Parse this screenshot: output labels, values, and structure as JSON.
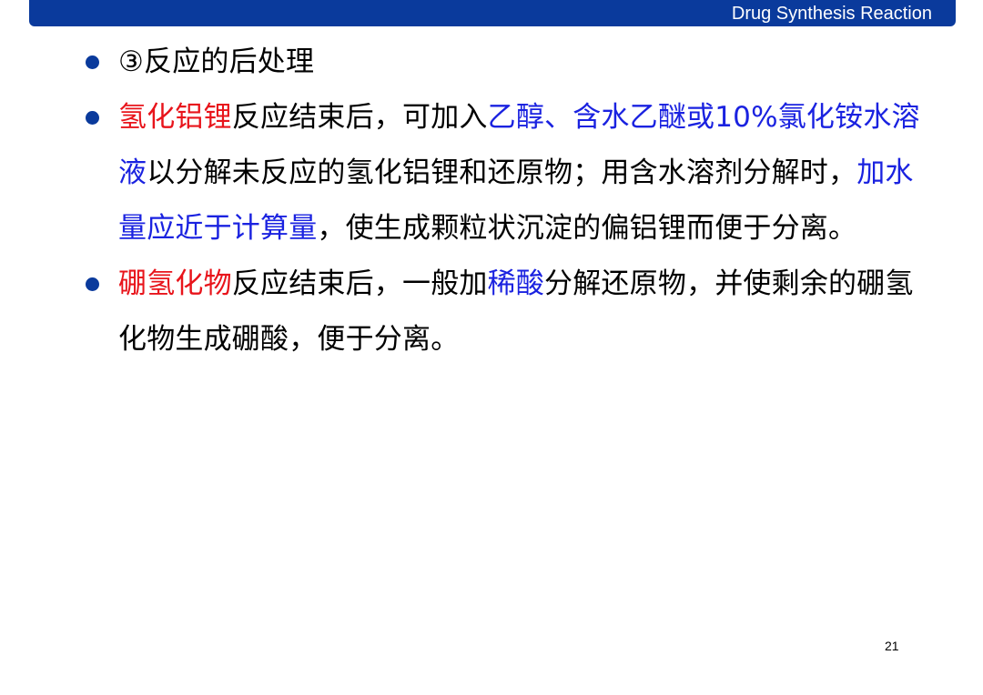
{
  "header": {
    "title": "Drug Synthesis Reaction"
  },
  "colors": {
    "header_bg": "#0a3a9c",
    "bullet": "#0a3a9c",
    "red_highlight": "#e8141b",
    "blue_highlight": "#1a22e0",
    "body_text": "#000000"
  },
  "bullets": [
    {
      "segments": [
        {
          "text": "③反应的后处理",
          "color": "black"
        }
      ]
    },
    {
      "segments": [
        {
          "text": "氢化铝锂",
          "color": "red"
        },
        {
          "text": "反应结束后，可加入",
          "color": "black"
        },
        {
          "text": "乙醇、含水乙醚或10%氯化铵水溶液",
          "color": "blue"
        },
        {
          "text": "以分解未反应的氢化铝锂和还原物；用含水溶剂分解时，",
          "color": "black"
        },
        {
          "text": "加水量应近于计算量",
          "color": "blue"
        },
        {
          "text": "，使生成颗粒状沉淀的偏铝锂而便于分离。",
          "color": "black"
        }
      ]
    },
    {
      "segments": [
        {
          "text": "硼氢化物",
          "color": "red"
        },
        {
          "text": "反应结束后，一般加",
          "color": "black"
        },
        {
          "text": "稀酸",
          "color": "blue"
        },
        {
          "text": "分解还原物，并使剩余的硼氢化物生成硼酸，便于分离。",
          "color": "black"
        }
      ]
    }
  ],
  "footer": {
    "page_number": "21"
  }
}
